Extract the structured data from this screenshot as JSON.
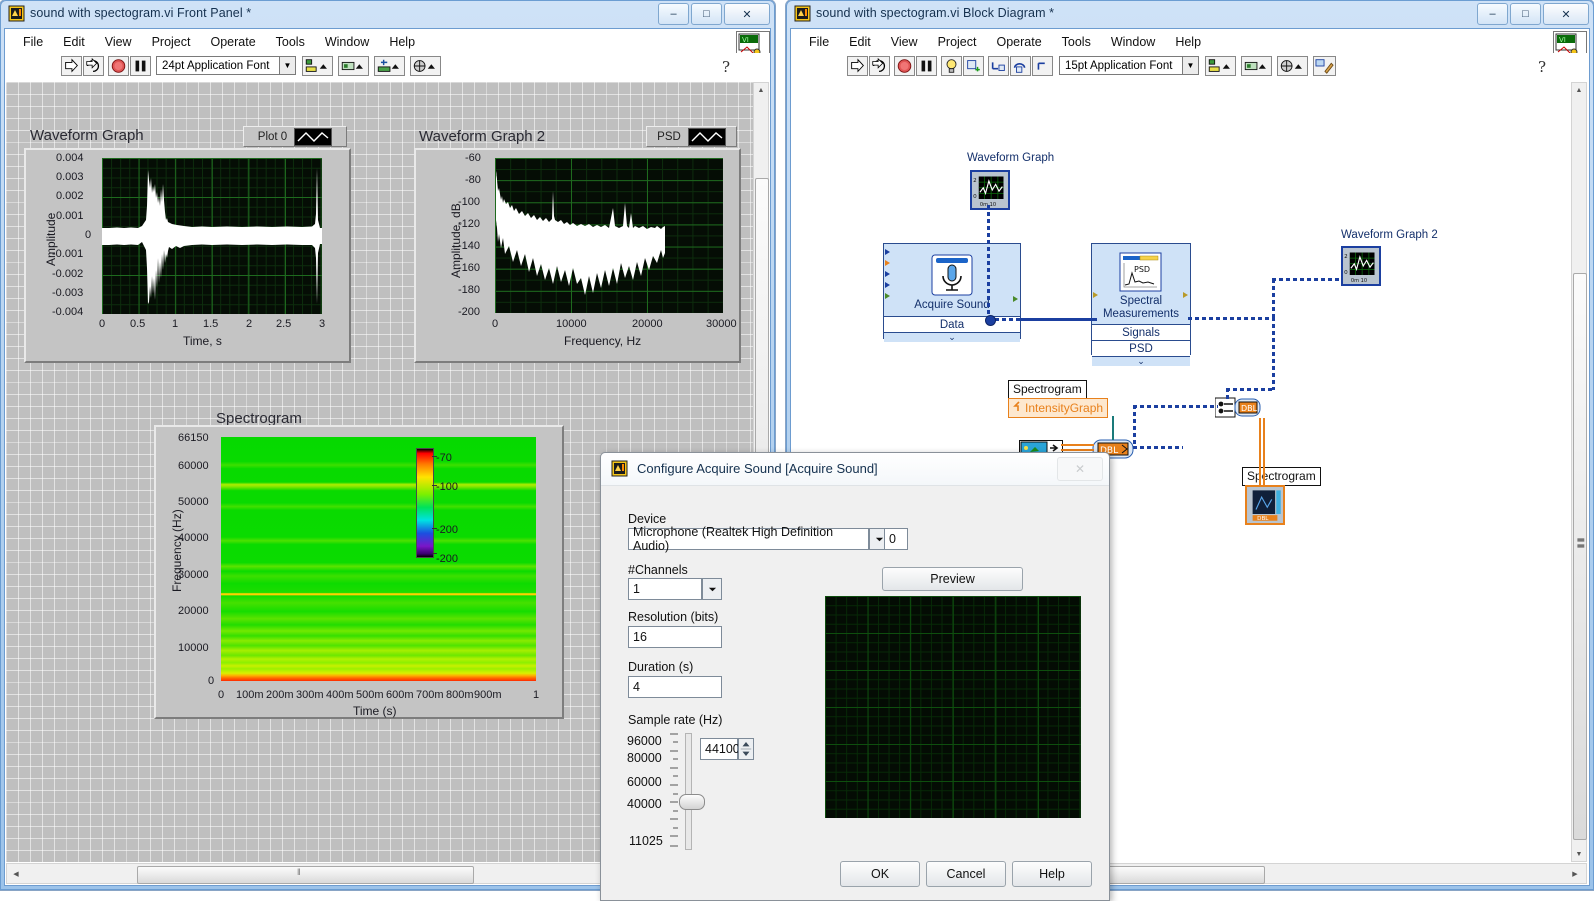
{
  "front_panel": {
    "window_title": "sound with spectogram.vi Front Panel *",
    "window_icon": "labview-vi-icon",
    "min_label": "–",
    "max_label": "□",
    "close_label": "✕",
    "menus": [
      "File",
      "Edit",
      "View",
      "Project",
      "Operate",
      "Tools",
      "Window",
      "Help"
    ],
    "toolbar": {
      "run": "run-arrow-icon",
      "run_continuous": "run-continuously-icon",
      "abort": "abort-execution-icon",
      "pause": "pause-icon",
      "font": "24pt Application Font",
      "align": "align-objects-icon",
      "distribute": "distribute-objects-icon",
      "resize": "resize-objects-icon",
      "reorder": "reorder-objects-icon",
      "help": "context-help-icon",
      "vi_icon": "vi-icon-pane"
    },
    "graph1": {
      "title": "Waveform Graph",
      "legend_label": "Plot 0",
      "y_label": "Amplitude",
      "x_label": "Time, s",
      "y_ticks": [
        "0.004",
        "0.003",
        "0.002",
        "0.001",
        "0",
        "-0.001",
        "-0.002",
        "-0.003",
        "-0.004"
      ],
      "x_ticks": [
        "0",
        "0.5",
        "1",
        "1.5",
        "2",
        "2.5",
        "3"
      ]
    },
    "graph2": {
      "title": "Waveform Graph 2",
      "legend_label": "PSD",
      "y_label": "Amplitude, dB",
      "x_label": "Frequency, Hz",
      "y_ticks": [
        "-60",
        "-80",
        "-100",
        "-120",
        "-140",
        "-160",
        "-180",
        "-200"
      ],
      "x_ticks": [
        "0",
        "10000",
        "20000",
        "30000"
      ]
    },
    "spectrogram": {
      "title": "Spectrogram",
      "y_label": "Frequency (Hz)",
      "x_label": "Time (s)",
      "y_ticks": [
        "66150",
        "60000",
        "50000",
        "40000",
        "30000",
        "20000",
        "10000",
        "0"
      ],
      "x_ticks": [
        "0",
        "100m",
        "200m",
        "300m",
        "400m",
        "500m",
        "600m",
        "700m",
        "800m",
        "900m",
        "1"
      ],
      "scale_ticks": [
        "-70",
        "-100",
        "-200",
        "-200"
      ]
    },
    "hscroll_grip": "‖"
  },
  "block_diagram": {
    "window_title": "sound with spectogram.vi Block Diagram *",
    "window_icon": "labview-vi-icon",
    "min_label": "–",
    "max_label": "□",
    "close_label": "✕",
    "menus": [
      "File",
      "Edit",
      "View",
      "Project",
      "Operate",
      "Tools",
      "Window",
      "Help"
    ],
    "toolbar": {
      "run": "run-arrow-icon",
      "run_continuous": "run-continuously-icon",
      "abort": "abort-execution-icon",
      "pause": "pause-icon",
      "highlight": "highlight-execution-bulb-icon",
      "retain": "retain-wire-values-icon",
      "step_into": "step-into-icon",
      "step_over": "step-over-icon",
      "step_out": "step-out-icon",
      "font": "15pt Application Font",
      "align": "align-objects-icon",
      "distribute": "distribute-objects-icon",
      "reorder": "reorder-objects-icon",
      "clean_up": "clean-up-diagram-icon",
      "help": "context-help-icon",
      "vi_icon": "vi-icon-pane"
    },
    "nodes": {
      "waveform_graph_label": "Waveform Graph",
      "waveform_graph2_label": "Waveform Graph 2",
      "acquire_sound_name": "Acquire Sound",
      "acquire_sound_out": "Data",
      "spectral_name_line1": "Spectral",
      "spectral_name_line2": "Measurements",
      "spectral_out1": "Signals",
      "spectral_out2": "PSD",
      "spectrogram_label": "Spectrogram",
      "intensity_graph_ref": "IntensityGraph",
      "spectrogram_terminal_label": "Spectrogram",
      "dbl_marker": "DBL"
    }
  },
  "dialog": {
    "title": "Configure Acquire Sound [Acquire Sound]",
    "icon": "labview-vi-icon",
    "close_label": "✕",
    "device_label": "Device",
    "device_value": "Microphone (Realtek High Definition Audio)",
    "device_index": "0",
    "channels_label": "#Channels",
    "channels_value": "1",
    "resolution_label": "Resolution (bits)",
    "resolution_value": "16",
    "duration_label": "Duration (s)",
    "duration_value": "4",
    "sample_rate_label": "Sample rate (Hz)",
    "sample_rate_value": "44100",
    "sample_rate_ticks": [
      "96000",
      "80000",
      "60000",
      "40000",
      "11025"
    ],
    "preview_label": "Preview",
    "ok_label": "OK",
    "cancel_label": "Cancel",
    "help_label": "Help"
  },
  "chart_data": [
    {
      "type": "line",
      "title": "Waveform Graph",
      "xlabel": "Time, s",
      "ylabel": "Amplitude",
      "xlim": [
        0,
        3
      ],
      "ylim": [
        -0.004,
        0.004
      ],
      "xticks": [
        0,
        0.5,
        1,
        1.5,
        2,
        2.5,
        3
      ],
      "yticks": [
        0.004,
        0.003,
        0.002,
        0.001,
        0,
        -0.001,
        -0.002,
        -0.003,
        -0.004
      ],
      "grid": true,
      "legend": [
        "Plot 0"
      ],
      "series": [
        {
          "name": "Plot 0",
          "description": "audio waveform envelope, noise floor +/-0.0004 with a loud burst between 0.55 s and 0.95 s peaking at +0.0034 / -0.0034, plus a narrow spike at 2.97 s reaching +0.003 / -0.0028",
          "envelope_x": [
            0,
            0.1,
            0.2,
            0.3,
            0.4,
            0.5,
            0.55,
            0.6,
            0.62,
            0.65,
            0.7,
            0.75,
            0.8,
            0.85,
            0.9,
            0.95,
            1.0,
            1.2,
            1.5,
            1.8,
            2.0,
            2.3,
            2.6,
            2.9,
            2.95,
            2.97,
            3.0
          ],
          "envelope_upper": [
            0.0004,
            0.0004,
            0.0004,
            0.0004,
            0.0004,
            0.0005,
            0.0012,
            0.0028,
            0.0034,
            0.003,
            0.0022,
            0.002,
            0.0027,
            0.0018,
            0.001,
            0.0006,
            0.0005,
            0.0005,
            0.0005,
            0.0005,
            0.0004,
            0.0004,
            0.0004,
            0.0005,
            0.0012,
            0.003,
            0.0004
          ],
          "envelope_lower": [
            -0.0004,
            -0.0004,
            -0.0004,
            -0.0004,
            -0.0004,
            -0.0005,
            -0.001,
            -0.0026,
            -0.0034,
            -0.0031,
            -0.0023,
            -0.0028,
            -0.0022,
            -0.0015,
            -0.0008,
            -0.0006,
            -0.0005,
            -0.0005,
            -0.0005,
            -0.0005,
            -0.0004,
            -0.0004,
            -0.0004,
            -0.0005,
            -0.0014,
            -0.0028,
            -0.0004
          ]
        }
      ]
    },
    {
      "type": "line",
      "title": "Waveform Graph 2",
      "xlabel": "Frequency, Hz",
      "ylabel": "Amplitude, dB",
      "xlim": [
        0,
        30000
      ],
      "ylim": [
        -200,
        -60
      ],
      "xticks": [
        0,
        10000,
        20000,
        30000
      ],
      "yticks": [
        -60,
        -80,
        -100,
        -120,
        -140,
        -160,
        -180,
        -200
      ],
      "grid": true,
      "legend": [
        "PSD"
      ],
      "series": [
        {
          "name": "PSD",
          "description": "power spectral density band; data ends at ~22050 Hz. Upper envelope falls from -72 dB at DC to about -120 dB by 4 kHz then flat to -122 dB; lower envelope from -127 dB down to about -165 dB, with tonal spikes near 8 kHz (-91 dB), 16 kHz (-105 dB) and 18 kHz (-103 dB)",
          "x": [
            0,
            500,
            1000,
            2000,
            4000,
            6000,
            8000,
            10000,
            12000,
            14000,
            16000,
            18000,
            20000,
            22050
          ],
          "upper_db": [
            -72,
            -88,
            -100,
            -110,
            -120,
            -118,
            -91,
            -117,
            -118,
            -119,
            -105,
            -103,
            -115,
            -122
          ],
          "lower_db": [
            -127,
            -140,
            -150,
            -168,
            -155,
            -160,
            -158,
            -163,
            -162,
            -168,
            -160,
            -165,
            -170,
            -168
          ]
        }
      ]
    },
    {
      "type": "heatmap",
      "title": "Spectrogram",
      "xlabel": "Time (s)",
      "ylabel": "Frequency (Hz)",
      "xlim": [
        0,
        1
      ],
      "ylim": [
        0,
        66150
      ],
      "xticks": [
        0,
        0.1,
        0.2,
        0.3,
        0.4,
        0.5,
        0.6,
        0.7,
        0.8,
        0.9,
        1
      ],
      "yticks": [
        0,
        10000,
        20000,
        30000,
        40000,
        50000,
        60000,
        66150
      ],
      "zlim": [
        -200,
        -70
      ],
      "colorbar_ticks": [
        -70,
        -100,
        -200,
        -200
      ],
      "colormap": "black-violet-blue-cyan-green-yellow-red-black",
      "description": "time-invariant spectrogram: horizontal bands, red/orange at 0 Hz, yellow-green bands near 1-5 kHz and 23500 Hz, uniform green elsewhere up to 66150 Hz"
    }
  ],
  "colors": {
    "plot_bg": "#050d05",
    "grid_green": "#1f7a1f",
    "trace_white": "#ffffff",
    "panel_gray": "#bfbfbf",
    "node_blue": "#cfe2f7",
    "wire_blue": "#1b3fa0",
    "wire_orange": "#e8811c",
    "title_blue": "#15314f"
  }
}
